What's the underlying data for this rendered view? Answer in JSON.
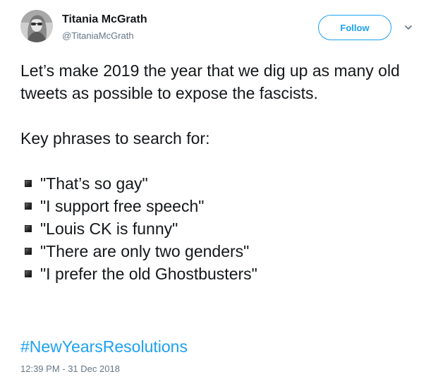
{
  "author": {
    "display_name": "Titania McGrath",
    "handle": "@TitaniaMcGrath"
  },
  "actions": {
    "follow_label": "Follow",
    "more_icon": "chevron-down-icon"
  },
  "tweet": {
    "paragraph_1": "Let’s make 2019 the year that we dig up as many old tweets as possible to expose the fascists.",
    "paragraph_2": "Key phrases to search for:",
    "bullets": [
      "\"That’s so gay\"",
      "\"I support free speech\"",
      "\"Louis CK is funny\"",
      "\"There are only two genders\"",
      "\"I prefer the old Ghostbusters\""
    ],
    "hashtag": "#NewYearsResolutions",
    "timestamp": "12:39 PM - 31 Dec 2018"
  },
  "colors": {
    "brand_blue": "#1da1f2",
    "muted_text": "#657786",
    "primary_text": "#14171a"
  }
}
